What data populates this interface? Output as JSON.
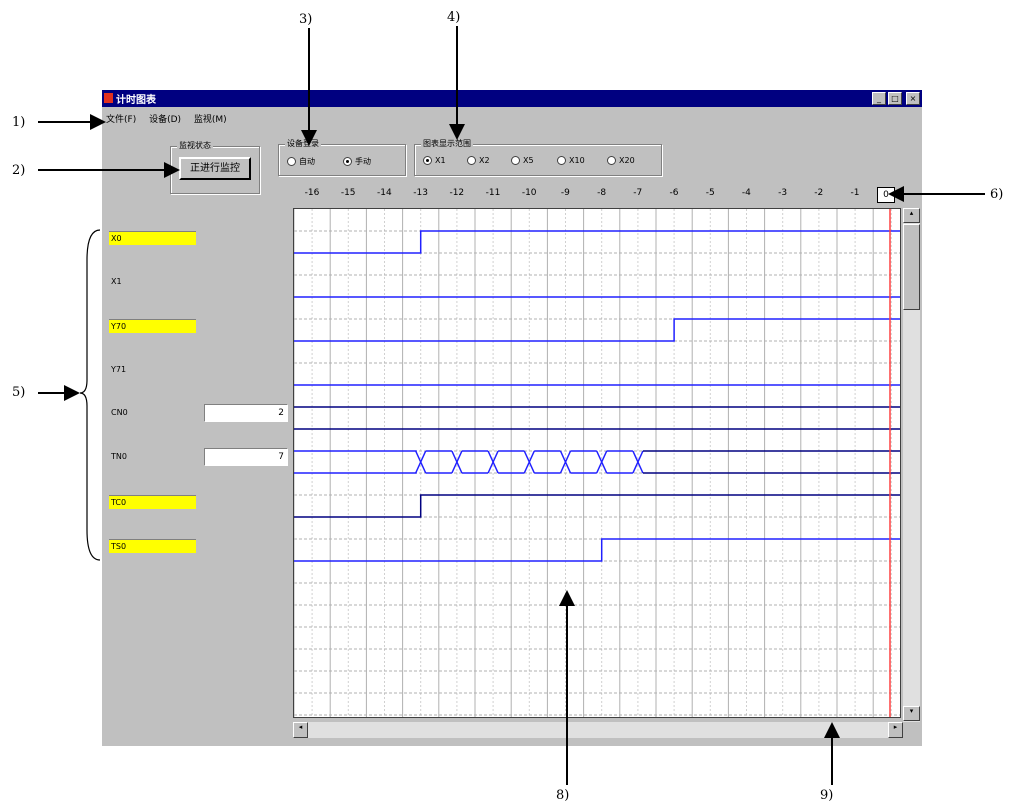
{
  "window": {
    "title": "计时图表",
    "buttons": [
      "_",
      "□",
      "×"
    ]
  },
  "menu": [
    "文件(F)",
    "设备(D)",
    "监视(M)"
  ],
  "monitor_group": {
    "title": "监视状态",
    "button_label": "正进行监控"
  },
  "sample_group": {
    "title": "设备登录",
    "options": [
      "自动",
      "手动"
    ],
    "selected": 1
  },
  "scale_group": {
    "title": "图表显示范围",
    "options": [
      "X1",
      "X2",
      "X5",
      "X10",
      "X20"
    ],
    "selected": 0
  },
  "time_axis": {
    "ticks": [
      "-16",
      "-15",
      "-14",
      "-13",
      "-12",
      "-11",
      "-10",
      "-9",
      "-8",
      "-7",
      "-6",
      "-5",
      "-4",
      "-3",
      "-2",
      "-1",
      "0"
    ]
  },
  "signals": [
    {
      "name": "X0",
      "highlight": true,
      "value": ""
    },
    {
      "name": "X1",
      "highlight": false,
      "value": ""
    },
    {
      "name": "Y70",
      "highlight": true,
      "value": ""
    },
    {
      "name": "Y71",
      "highlight": false,
      "value": ""
    },
    {
      "name": "CN0",
      "highlight": false,
      "value": "2"
    },
    {
      "name": "TN0",
      "highlight": false,
      "value": "7"
    },
    {
      "name": "TC0",
      "highlight": true,
      "value": ""
    },
    {
      "name": "TS0",
      "highlight": true,
      "value": ""
    }
  ],
  "callouts": [
    "1)",
    "2)",
    "3)",
    "4)",
    "5)",
    "6)",
    "8)",
    "9)"
  ],
  "colors": {
    "title_bar": "#000080",
    "trace": "#2020ff",
    "trace_dark": "#000080",
    "highlight": "#ffff00",
    "cursor": "#ff4040",
    "grid": "#808080"
  },
  "icons": [
    "app-icon",
    "minimize-icon",
    "maximize-icon",
    "close-icon",
    "scroll-up-icon",
    "scroll-down-icon",
    "scroll-left-icon",
    "scroll-right-icon"
  ]
}
